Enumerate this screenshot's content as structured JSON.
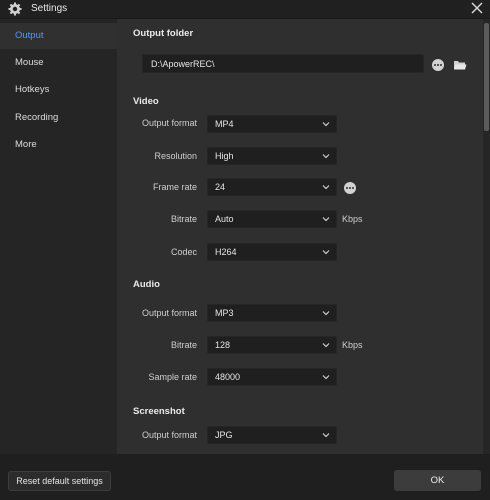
{
  "window": {
    "title": "Settings"
  },
  "sidebar": {
    "items": [
      {
        "label": "Output",
        "active": true
      },
      {
        "label": "Mouse"
      },
      {
        "label": "Hotkeys"
      },
      {
        "label": "Recording"
      },
      {
        "label": "More"
      }
    ]
  },
  "output_folder": {
    "title": "Output folder",
    "path": "D:\\ApowerREC\\"
  },
  "video": {
    "title": "Video",
    "output_format": {
      "label": "Output format",
      "value": "MP4"
    },
    "resolution": {
      "label": "Resolution",
      "value": "High"
    },
    "frame_rate": {
      "label": "Frame rate",
      "value": "24"
    },
    "bitrate": {
      "label": "Bitrate",
      "value": "Auto",
      "unit": "Kbps"
    },
    "codec": {
      "label": "Codec",
      "value": "H264"
    }
  },
  "audio": {
    "title": "Audio",
    "output_format": {
      "label": "Output format",
      "value": "MP3"
    },
    "bitrate": {
      "label": "Bitrate",
      "value": "128",
      "unit": "Kbps"
    },
    "sample_rate": {
      "label": "Sample rate",
      "value": "48000"
    }
  },
  "screenshot": {
    "title": "Screenshot",
    "output_format": {
      "label": "Output format",
      "value": "JPG"
    }
  },
  "footer": {
    "reset_label": "Reset default settings",
    "ok_label": "OK"
  },
  "colors": {
    "accent": "#4e9bf7",
    "background": "#2f2f2f",
    "sidebar": "#252525"
  },
  "icons": [
    "gear-icon",
    "close-icon",
    "more-icon",
    "folder-icon",
    "chevron-down-icon"
  ]
}
